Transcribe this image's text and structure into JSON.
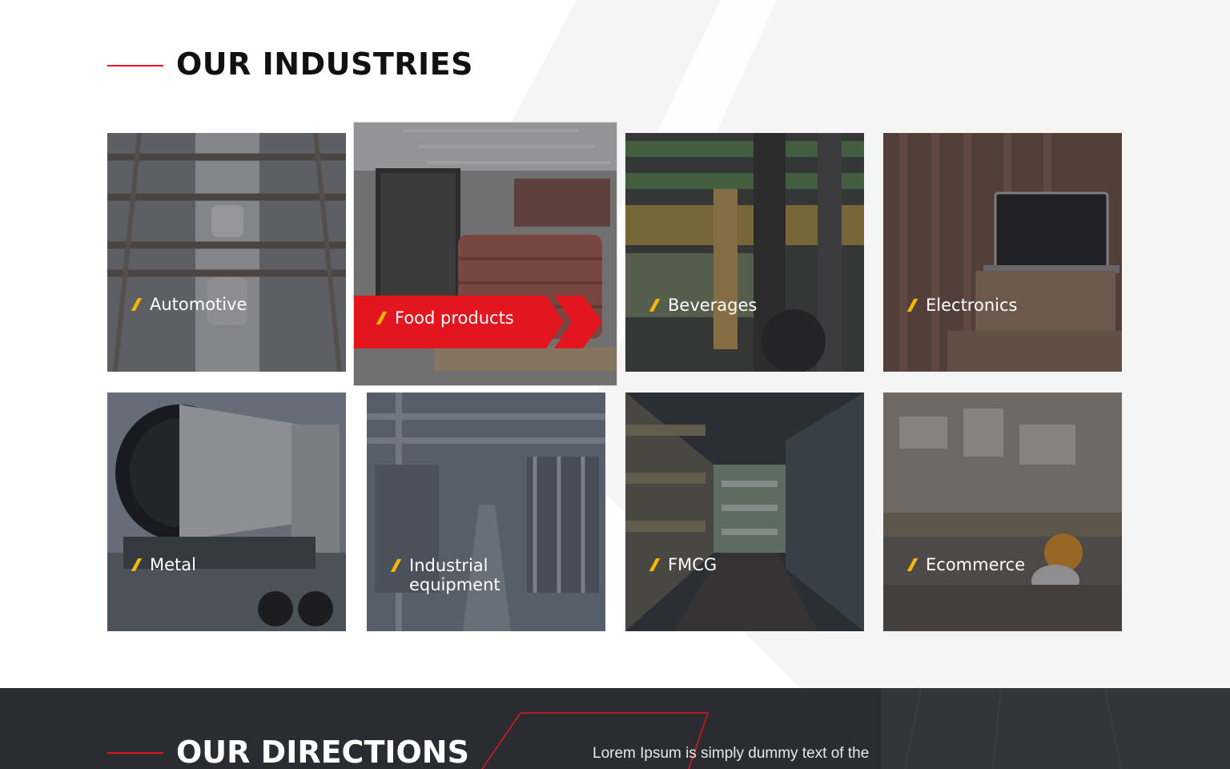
{
  "industries": {
    "title": "OUR INDUSTRIES",
    "items": [
      {
        "label": "Automotive",
        "photo": "automotive-assembly-line"
      },
      {
        "label": "Food products",
        "photo": "forklift-food-sacks",
        "active": true
      },
      {
        "label": "Beverages",
        "photo": "forklift-beverage-shelves"
      },
      {
        "label": "Electronics",
        "photo": "laptop-on-boxes"
      },
      {
        "label": "Metal",
        "photo": "truck-with-metal-pipe"
      },
      {
        "label": "Industrial equipment",
        "label_line1": "Industrial",
        "label_line2": "equipment",
        "photo": "factory-pipes"
      },
      {
        "label": "FMCG",
        "photo": "supermarket-aisle"
      },
      {
        "label": "Ecommerce",
        "photo": "warehouse-worker-topdown"
      }
    ]
  },
  "directions": {
    "title": "OUR DIRECTIONS",
    "text": "Lorem Ipsum is simply dummy text of the"
  },
  "colors": {
    "accent": "#e3161f",
    "slash": "#f5b800",
    "dark_bg": "#2b2c31"
  }
}
